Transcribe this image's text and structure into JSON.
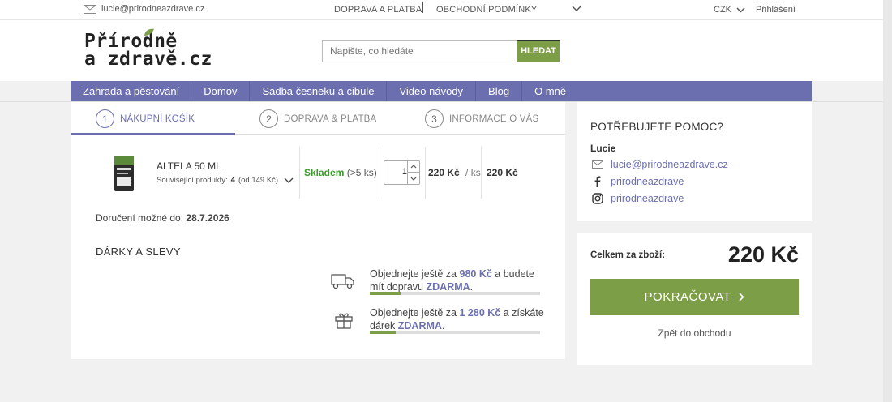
{
  "topbar": {
    "email": "lucie@prirodneazdrave.cz",
    "nav": [
      "DOPRAVA A PLATBA",
      "OBCHODNÍ PODMÍNKY"
    ],
    "currency": "CZK",
    "login": "Přihlášení"
  },
  "header": {
    "logo_line1": "Přírodně",
    "logo_line2": "a zdravě.cz",
    "search_placeholder": "Napište, co hledáte",
    "search_button": "HLEDAT"
  },
  "categories": [
    "Zahrada a pěstování",
    "Domov",
    "Sadba česneku a cibule",
    "Video návody",
    "Blog",
    "O mně"
  ],
  "steps": [
    {
      "num": "1",
      "label": "NÁKUPNÍ KOŠÍK",
      "active": true
    },
    {
      "num": "2",
      "label": "DOPRAVA & PLATBA",
      "active": false
    },
    {
      "num": "3",
      "label": "INFORMACE O VÁS",
      "active": false
    }
  ],
  "cart_item": {
    "name": "ALTELA 50 ML",
    "related_label": "Související produkty:",
    "related_count": "4",
    "related_from": "(od 149 Kč)",
    "stock_status": "Skladem",
    "stock_qty": "(>5 ks)",
    "quantity": "1",
    "unit_price": "220 Kč",
    "unit": "/ ks",
    "total_price": "220 Kč"
  },
  "delivery": {
    "label": "Doručení možné do:",
    "date": "28.7.2026"
  },
  "gifts_title": "DÁRKY A SLEVY",
  "promos": [
    {
      "icon": "truck-icon",
      "t1": "Objednejte ještě za",
      "amount": "980 Kč",
      "t2": "a budete mít dopravu",
      "free": "ZDARMA",
      "end": ".",
      "progress": 0.18
    },
    {
      "icon": "gift-icon",
      "t1": "Objednejte ještě za",
      "amount": "1 280 Kč",
      "t2": "a získáte dárek",
      "free": "ZDARMA",
      "end": ".",
      "progress": 0.15
    }
  ],
  "help": {
    "title": "POTŘEBUJETE POMOC?",
    "name": "Lucie",
    "email": "lucie@prirodneazdrave.cz",
    "facebook": "prirodneazdrave",
    "instagram": "prirodneazdrave"
  },
  "summary": {
    "label": "Celkem za zboží:",
    "amount": "220 Kč",
    "continue": "POKRAČOVAT",
    "back": "Zpět do obchodu"
  },
  "colors": {
    "accent": "#6b6fb0",
    "green": "#7c9e46",
    "stock_green": "#3a9a2a"
  }
}
